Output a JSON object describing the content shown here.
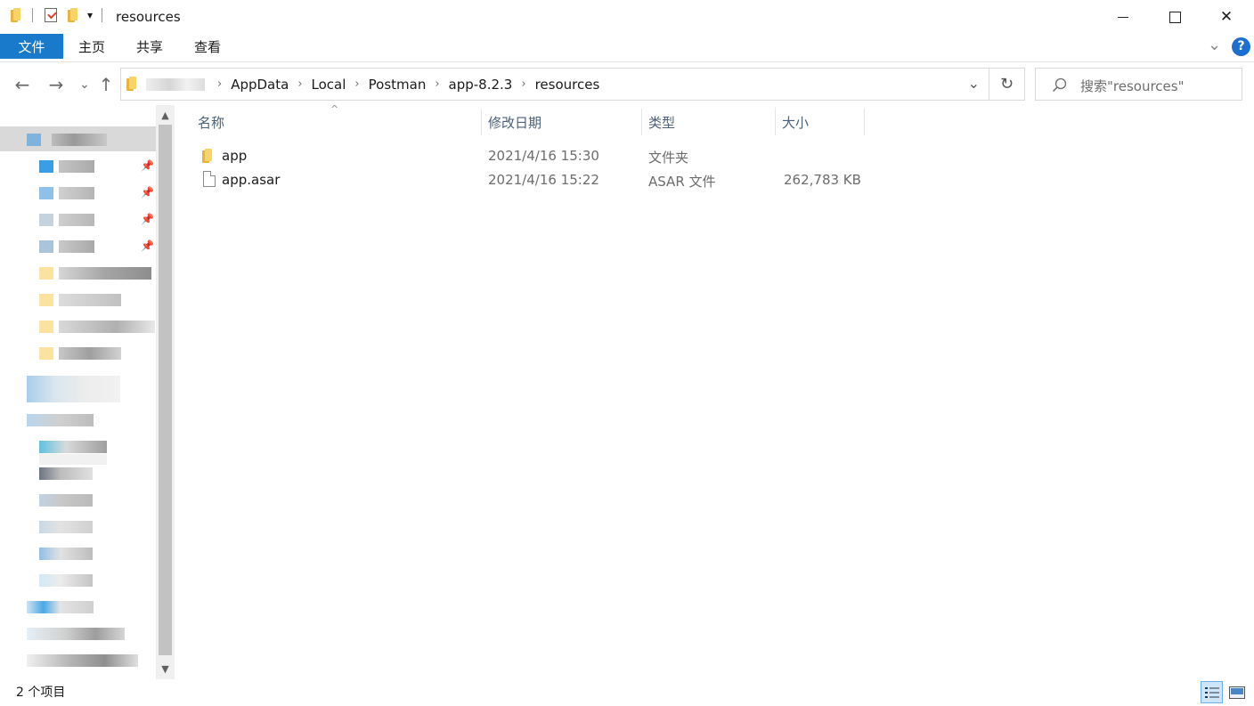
{
  "titlebar": {
    "title": "resources",
    "qat_dropdown": "▾",
    "minimize": "—",
    "maximize": "☐",
    "close": "✕"
  },
  "ribbon": {
    "tabs": [
      "文件",
      "主页",
      "共享",
      "查看"
    ],
    "help": "?",
    "collapse": "⌄"
  },
  "nav": {
    "back": "←",
    "forward": "→",
    "recent": "⌄",
    "up": "↑"
  },
  "address": {
    "breadcrumbs": [
      "AppData",
      "Local",
      "Postman",
      "app-8.2.3",
      "resources"
    ],
    "separator": "›",
    "dropdown": "⌄",
    "refresh": "↻"
  },
  "search": {
    "placeholder": "搜索\"resources\"",
    "icon": "search-icon"
  },
  "columns": {
    "name": "名称",
    "modified": "修改日期",
    "type": "类型",
    "size": "大小"
  },
  "files": [
    {
      "name": "app",
      "modified": "2021/4/16 15:30",
      "type": "文件夹",
      "size": "",
      "icon": "folder-icon"
    },
    {
      "name": "app.asar",
      "modified": "2021/4/16 15:22",
      "type": "ASAR 文件",
      "size": "262,783 KB",
      "icon": "file-icon"
    }
  ],
  "status": {
    "item_count": "2 个项目"
  },
  "colors": {
    "accent": "#1979ca",
    "folder": "#f7d46b",
    "header_text": "#4c607a"
  }
}
